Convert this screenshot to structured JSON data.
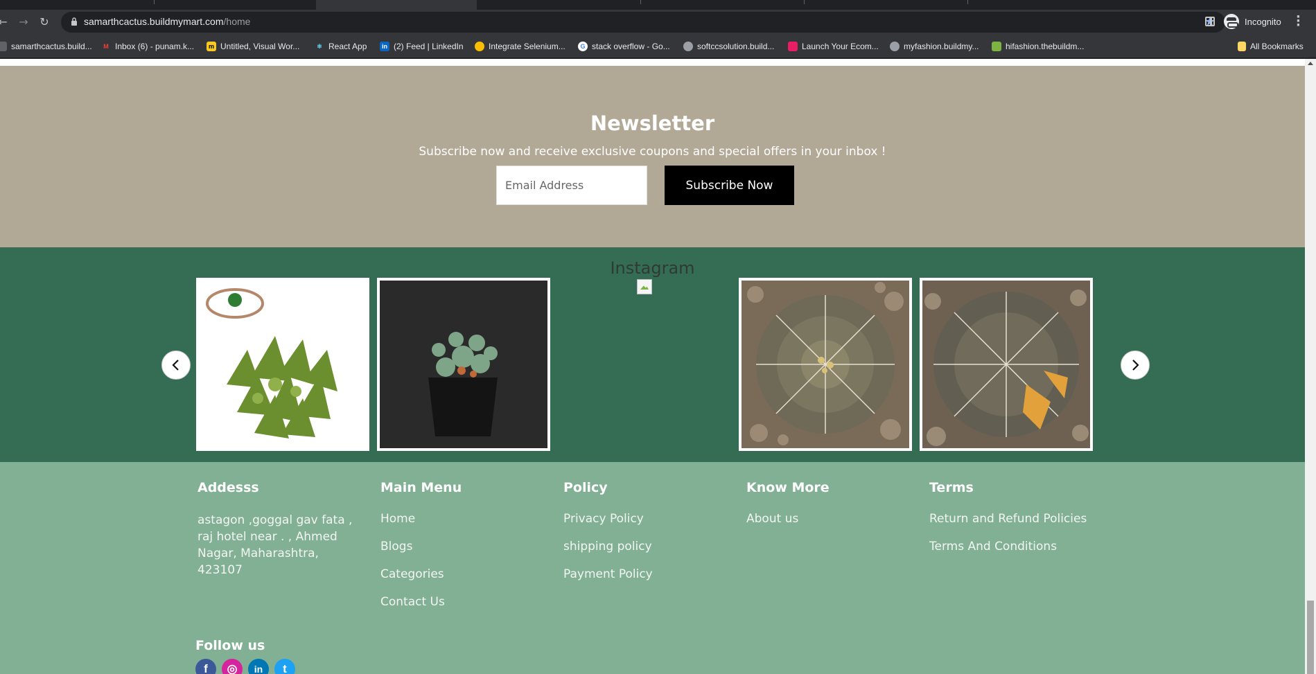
{
  "browser": {
    "url_host": "samarthcactus.buildmymart.com",
    "url_path": "/home",
    "incognito_label": "Incognito",
    "bookmarks": [
      {
        "label": "samarthcactus.build...",
        "icon": "site-icon",
        "color": "#8ab4f8"
      },
      {
        "label": "Inbox (6) - punam.k...",
        "icon": "gmail-icon",
        "color": "#ea4335"
      },
      {
        "label": "Untitled, Visual Wor...",
        "icon": "miro-icon",
        "color": "#f7c922"
      },
      {
        "label": "React App",
        "icon": "react-icon",
        "color": "#61dafb"
      },
      {
        "label": "(2) Feed | LinkedIn",
        "icon": "linkedin-icon",
        "color": "#0a66c2"
      },
      {
        "label": "Integrate Selenium...",
        "icon": "chrome-icon",
        "color": "#fbbc04"
      },
      {
        "label": "stack overflow - Go...",
        "icon": "google-icon",
        "color": "#4285f4"
      },
      {
        "label": "softccsolution.build...",
        "icon": "globe-icon",
        "color": "#9aa0a6"
      },
      {
        "label": "Launch Your Ecom...",
        "icon": "shop-icon",
        "color": "#e91e63"
      },
      {
        "label": "myfashion.buildmy...",
        "icon": "globe-icon",
        "color": "#9aa0a6"
      },
      {
        "label": "hifashion.thebuildm...",
        "icon": "leaf-icon",
        "color": "#7cb342"
      }
    ],
    "all_bookmarks_label": "All Bookmarks"
  },
  "newsletter": {
    "title": "Newsletter",
    "subtitle": "Subscribe now and receive exclusive coupons and special offers in your inbox !",
    "email_placeholder": "Email Address",
    "button_label": "Subscribe Now"
  },
  "instagram": {
    "title": "Instagram"
  },
  "footer": {
    "address": {
      "heading": "Addesss",
      "text": "astagon ,goggal gav fata , raj hotel near . , Ahmed Nagar, Maharashtra, 423107"
    },
    "main_menu": {
      "heading": "Main Menu",
      "links": [
        "Home",
        "Blogs",
        "Categories",
        "Contact Us"
      ]
    },
    "policy": {
      "heading": "Policy",
      "links": [
        "Privacy Policy",
        "shipping policy",
        "Payment Policy"
      ]
    },
    "know_more": {
      "heading": "Know More",
      "links": [
        "About us"
      ]
    },
    "terms": {
      "heading": "Terms",
      "links": [
        "Return and Refund Policies",
        "Terms And Conditions"
      ]
    },
    "follow_us": "Follow us",
    "social": [
      {
        "name": "facebook-icon",
        "glyph": "f",
        "color": "#3b5998"
      },
      {
        "name": "instagram-icon",
        "glyph": "◎",
        "color": "#d6249f"
      },
      {
        "name": "linkedin-icon",
        "glyph": "in",
        "color": "#0077b5"
      },
      {
        "name": "twitter-icon",
        "glyph": "t",
        "color": "#1da1f2"
      }
    ]
  },
  "colors": {
    "newsletter_bg": "#b1a996",
    "instagram_bg": "#356d54",
    "footer_bg": "#82b094",
    "button_bg": "#000000"
  }
}
